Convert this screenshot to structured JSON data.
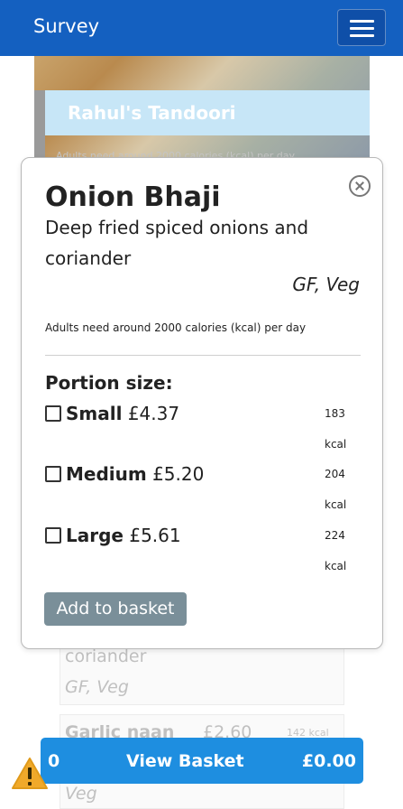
{
  "navbar": {
    "brand": "Survey",
    "menu_icon": "hamburger-icon"
  },
  "background": {
    "restaurant_name": "Rahul's Tandoori",
    "calorie_note": "Adults need around 2000 calories (kcal) per day",
    "partial_items": [
      {
        "line1": "coriander",
        "diet": "GF, Veg"
      },
      {
        "name": "Garlic naan",
        "price": "£2.60",
        "kcal": "142 kcal",
        "diet": "Veg"
      }
    ]
  },
  "modal": {
    "title": "Onion Bhaji",
    "description": "Deep fried spiced onions and coriander",
    "diet": "GF, Veg",
    "calorie_note": "Adults need around 2000 calories (kcal) per day",
    "portion_label": "Portion size:",
    "options": [
      {
        "name": "Small",
        "price": "£4.37",
        "kcal": "183",
        "unit": "kcal"
      },
      {
        "name": "Medium",
        "price": "£5.20",
        "kcal": "204",
        "unit": "kcal"
      },
      {
        "name": "Large",
        "price": "£5.61",
        "kcal": "224",
        "unit": "kcal"
      }
    ],
    "add_button": "Add to basket",
    "close_icon": "close-icon"
  },
  "basket": {
    "count": "0",
    "label": "View Basket",
    "total": "£0.00"
  },
  "colors": {
    "navbar": "#1460c0",
    "basket_bar": "#1e8ee0",
    "add_button": "#7a8f99",
    "banner": "#c7e6f7",
    "warning": "#f0a92a"
  }
}
